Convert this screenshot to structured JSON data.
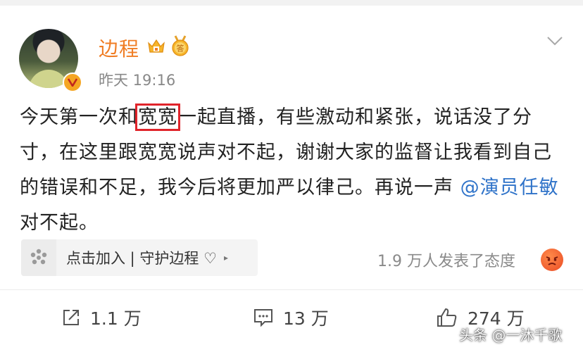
{
  "user": {
    "name": "边程",
    "timestamp": "昨天 19:16",
    "medal_text": "答"
  },
  "post": {
    "part1": "今天第一次和",
    "highlight": "宽宽",
    "part2": "一起直播，有些激动和紧张，说话没了分寸，在这里跟宽宽说声对不起，谢谢大家的监督让我看到自己的错误和不足，我今后将更加严以律己。再说一声 ",
    "mention": "@演员任敏",
    "part3": " 对不起。"
  },
  "supertopic": {
    "label": "点击加入 | 守护边程 ♡",
    "arrow": "▸"
  },
  "reactions": {
    "text": "1.9 万人发表了态度"
  },
  "actions": {
    "repost": "1.1 万",
    "comment": "13 万",
    "like": "274 万"
  },
  "watermark": "头条 @一沐千歌",
  "colors": {
    "username": "#f07d24",
    "mention": "#2f73c9",
    "highlight_box": "#e0242b"
  }
}
